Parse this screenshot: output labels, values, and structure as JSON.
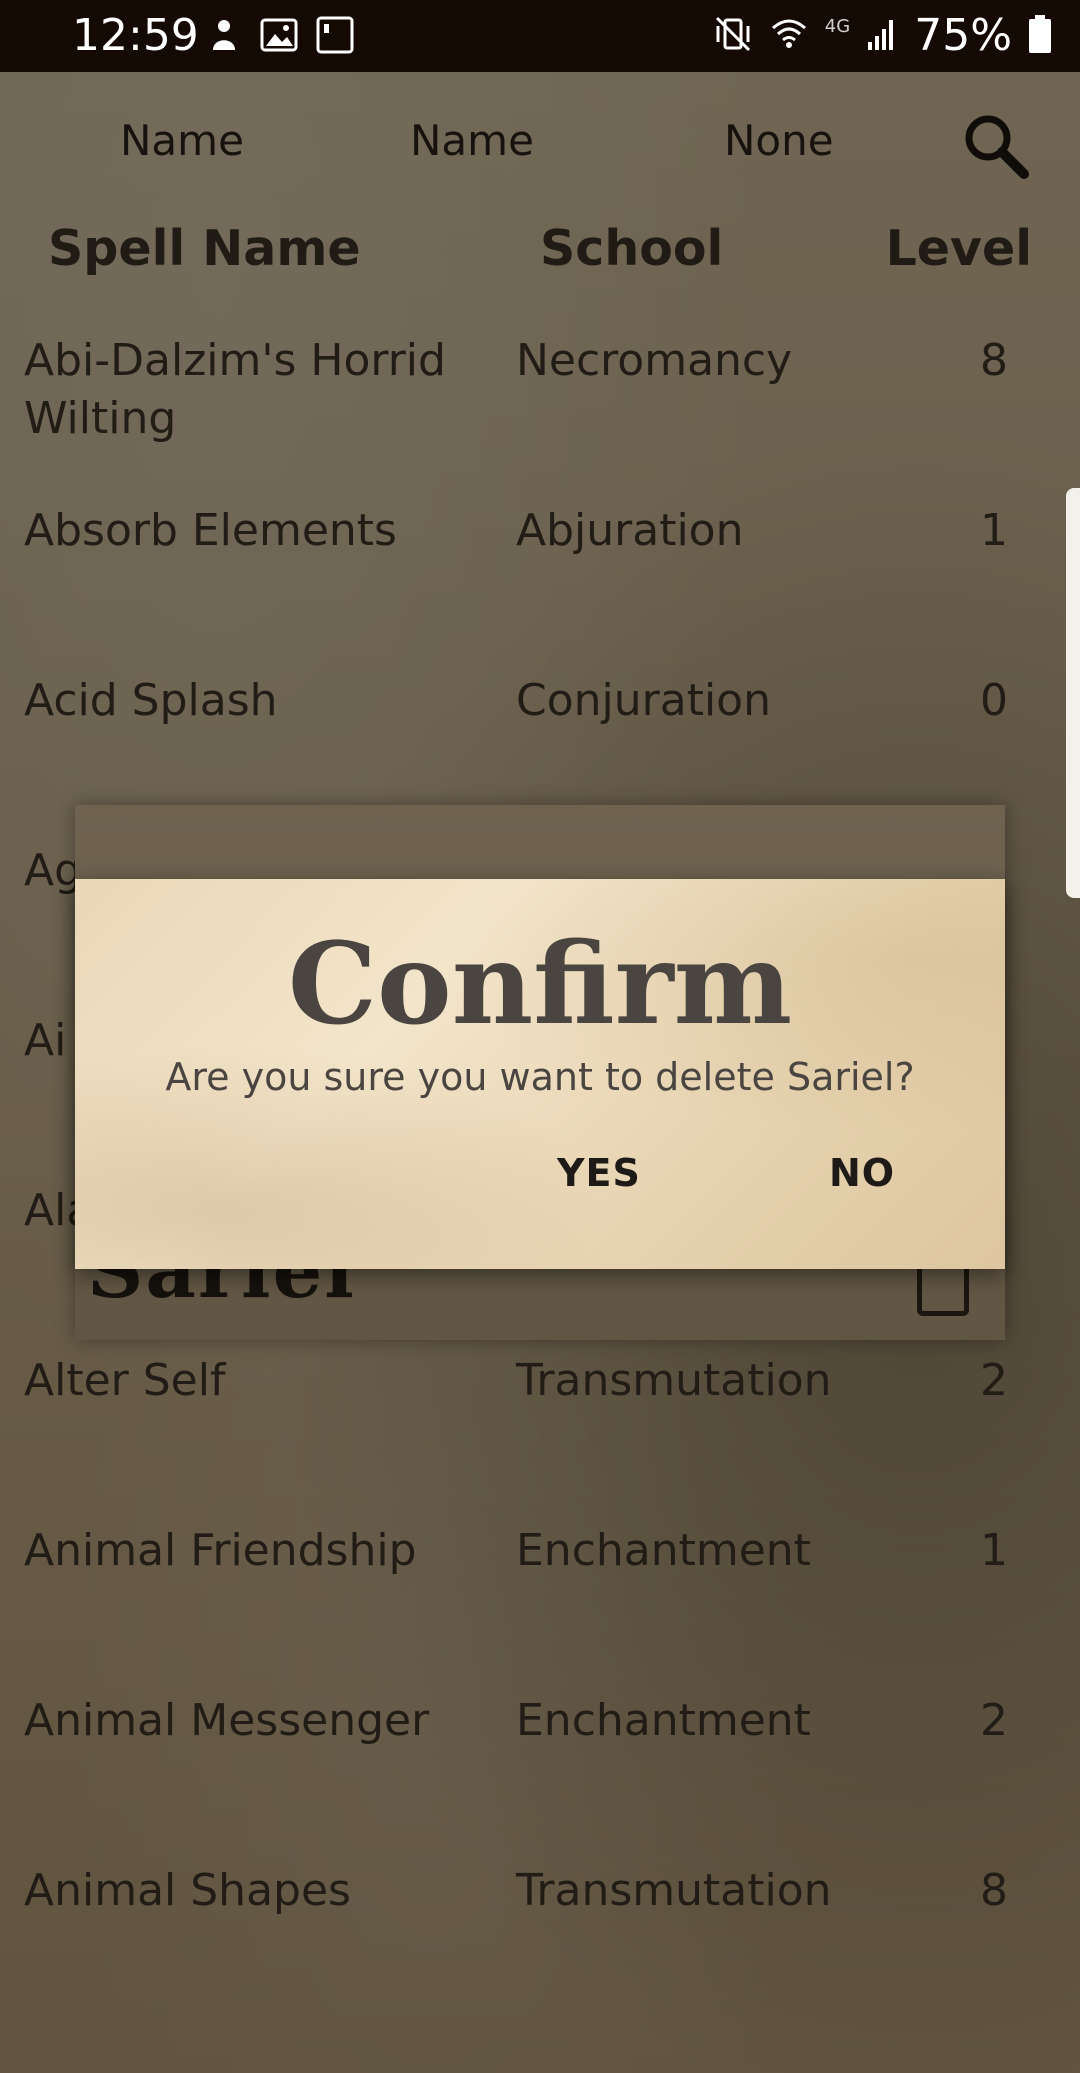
{
  "status_bar": {
    "time": "12:59",
    "battery": "75%",
    "network": "4G"
  },
  "sort_bar": {
    "sort1": "Name",
    "sort2": "Name",
    "filter": "None"
  },
  "columns": {
    "name": "Spell Name",
    "school": "School",
    "level": "Level"
  },
  "spells": [
    {
      "name": "Abi-Dalzim's Horrid Wilting",
      "school": "Necromancy",
      "level": "8"
    },
    {
      "name": "Absorb Elements",
      "school": "Abjuration",
      "level": "1"
    },
    {
      "name": "Acid Splash",
      "school": "Conjuration",
      "level": "0"
    },
    {
      "name": "Ag",
      "school": "",
      "level": ""
    },
    {
      "name": "Ai",
      "school": "",
      "level": ""
    },
    {
      "name": "Ala",
      "school": "",
      "level": ""
    },
    {
      "name": "Alter Self",
      "school": "Transmutation",
      "level": "2"
    },
    {
      "name": "Animal Friendship",
      "school": "Enchantment",
      "level": "1"
    },
    {
      "name": "Animal Messenger",
      "school": "Enchantment",
      "level": "2"
    },
    {
      "name": "Animal Shapes",
      "school": "Transmutation",
      "level": "8"
    }
  ],
  "character_dialog": {
    "name": "Sariel"
  },
  "confirm_dialog": {
    "title": "Confirm",
    "message": "Are you sure you want to delete Sariel?",
    "yes": "YES",
    "no": "NO"
  }
}
